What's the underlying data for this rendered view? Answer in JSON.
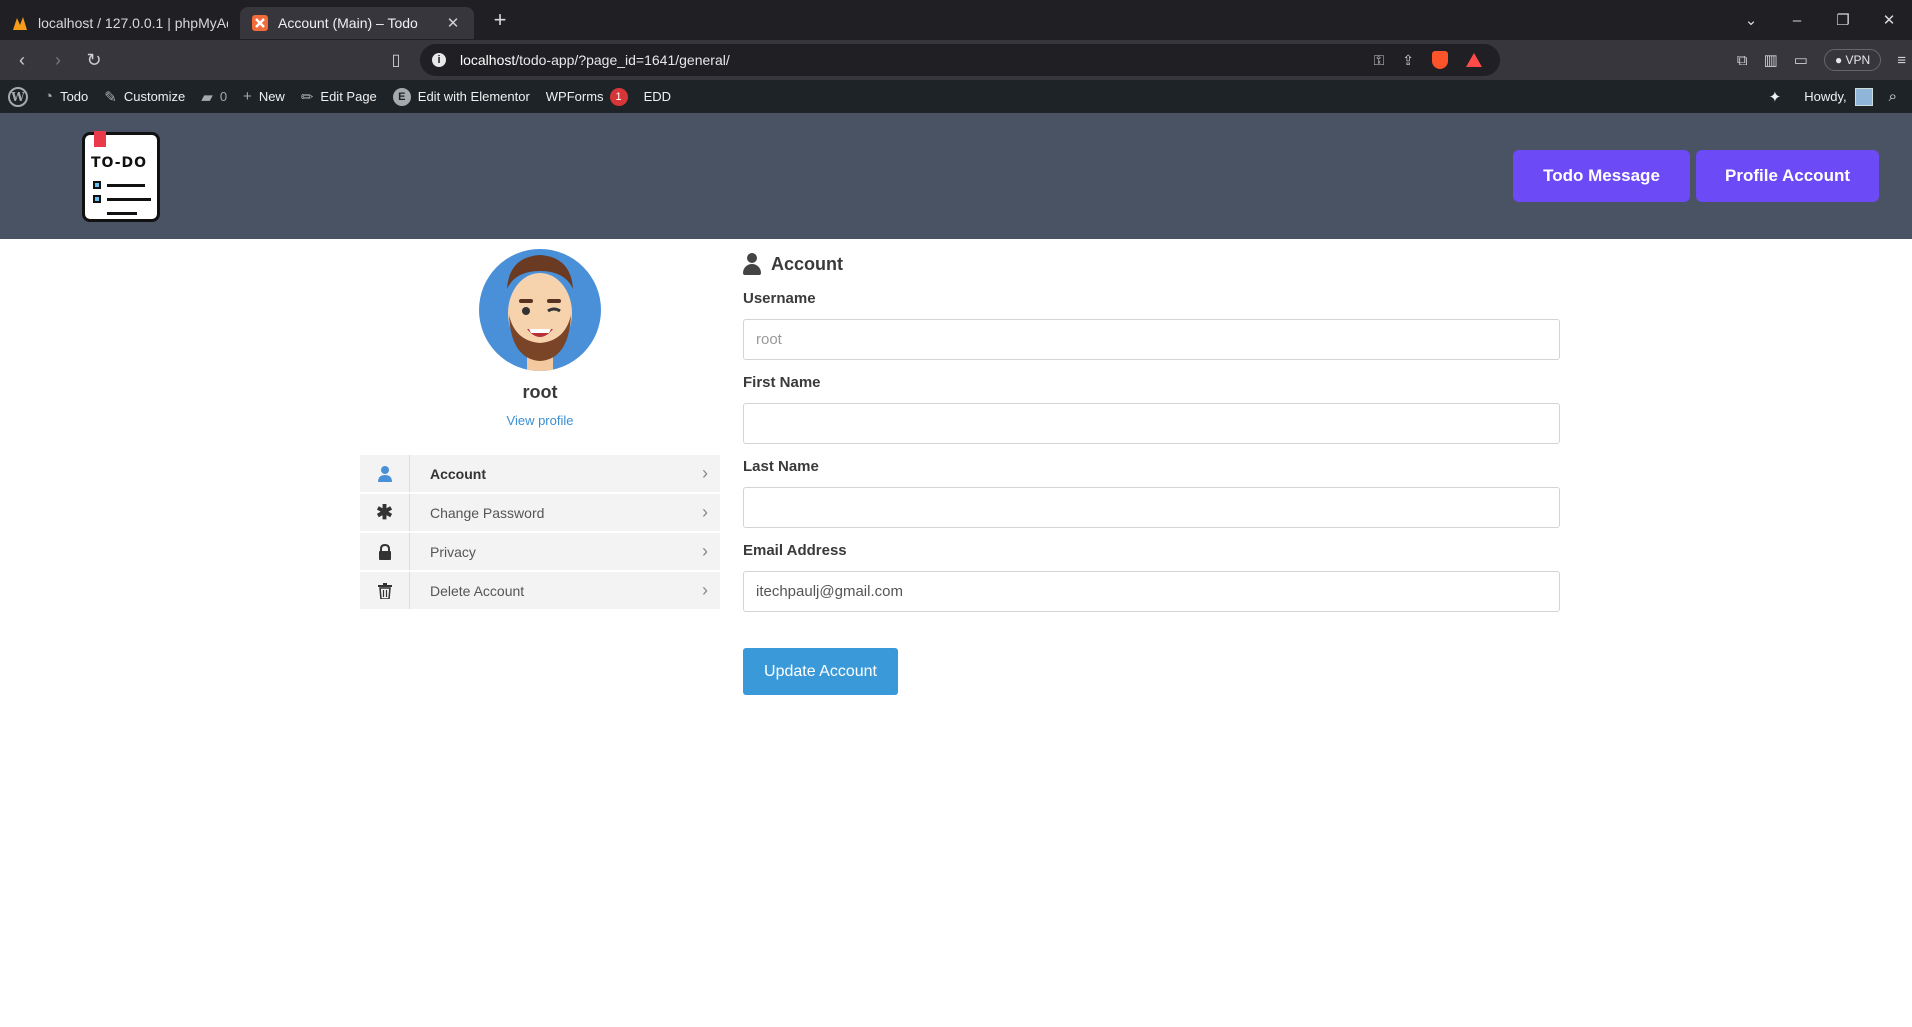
{
  "browser": {
    "tabs": [
      {
        "title": "localhost / 127.0.0.1 | phpMyAdmin",
        "active": false
      },
      {
        "title": "Account (Main) – Todo",
        "active": true
      }
    ],
    "url_host": "localhost",
    "url_path": "/todo-app/?page_id=1641/general/",
    "vpn_label": "VPN"
  },
  "adminbar": {
    "site": "Todo",
    "customize": "Customize",
    "comments": "0",
    "new": "New",
    "edit_page": "Edit Page",
    "edit_elementor": "Edit with Elementor",
    "wpforms": "WPForms",
    "wpforms_badge": "1",
    "edd": "EDD",
    "howdy": "Howdy,"
  },
  "header": {
    "logo_text": "TO-DO",
    "todo_button": "Todo Message",
    "profile_button": "Profile Account",
    "accent": "#6c4af6",
    "bg": "#4a5363"
  },
  "sidebar": {
    "username": "root",
    "view_profile": "View profile",
    "items": [
      {
        "label": "Account",
        "icon": "user-icon",
        "active": true
      },
      {
        "label": "Change Password",
        "icon": "asterisk-icon",
        "active": false
      },
      {
        "label": "Privacy",
        "icon": "lock-icon",
        "active": false
      },
      {
        "label": "Delete Account",
        "icon": "trash-icon",
        "active": false
      }
    ]
  },
  "form": {
    "title": "Account",
    "username_label": "Username",
    "username_value": "root",
    "first_name_label": "First Name",
    "first_name_value": "",
    "last_name_label": "Last Name",
    "last_name_value": "",
    "email_label": "Email Address",
    "email_value": "itechpaulj@gmail.com",
    "submit": "Update Account",
    "submit_color": "#3a9ad9"
  }
}
